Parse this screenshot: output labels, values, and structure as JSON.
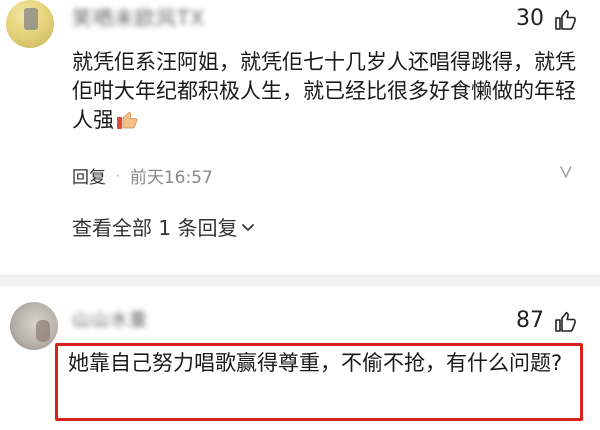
{
  "comments": [
    {
      "username": "笑哂未欧风TX",
      "likes": "30",
      "text": "就凭佢系汪阿姐，就凭佢七十几岁人还唱得跳得，就凭佢咁大年纪都积极人生，就已经比很多好食懒做的年轻人强",
      "reply_label": "回复",
      "separator": "·",
      "time": "前天16:57",
      "view_replies": "查看全部 1 条回复"
    },
    {
      "username": "山山水重",
      "likes": "87",
      "text": "她靠自己努力唱歌赢得尊重，不偷不抢，有什么问题?"
    }
  ],
  "colors": {
    "highlight_border": "#d9221c",
    "divider": "#f2f2f2"
  },
  "icons": {
    "like": "thumbs-up-icon",
    "more": "more-icon",
    "expand": "chevron-down-icon",
    "emoji": "thumbs-up-emoji-icon"
  }
}
